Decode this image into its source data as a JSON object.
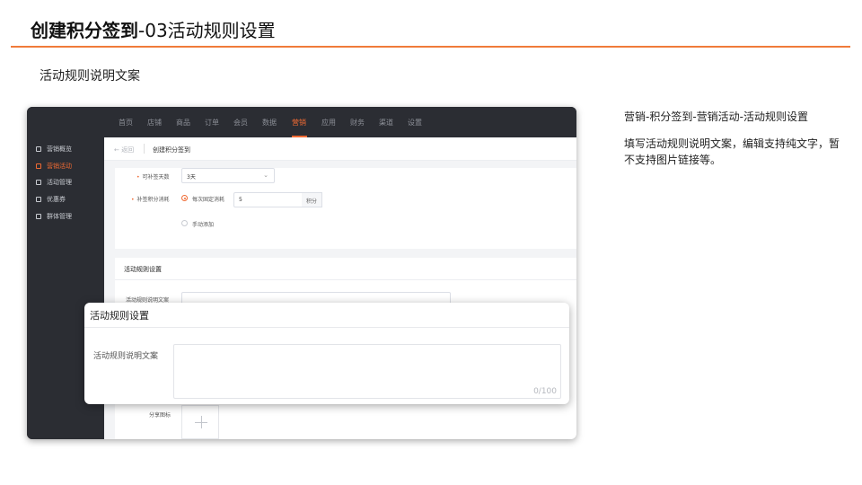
{
  "slide": {
    "title_bold": "创建积分签到",
    "title_rest": "-03活动规则设置",
    "subtitle": "活动规则说明文案"
  },
  "colors": {
    "accent": "#f06a33",
    "rule": "#f07b3a",
    "nav_bg": "#2b2d33"
  },
  "topnav": {
    "items": [
      "首页",
      "店铺",
      "商品",
      "订单",
      "会员",
      "数据",
      "营销",
      "应用",
      "财务",
      "渠道",
      "设置"
    ],
    "active": "营销"
  },
  "sidebar": {
    "items": [
      {
        "label": "营销概览",
        "icon": "overview-icon",
        "active": false
      },
      {
        "label": "营销活动",
        "icon": "tag-icon",
        "active": true
      },
      {
        "label": "活动管理",
        "icon": "calendar-icon",
        "active": false
      },
      {
        "label": "优惠券",
        "icon": "coupon-icon",
        "active": false
      },
      {
        "label": "群体管理",
        "icon": "group-icon",
        "active": false
      }
    ]
  },
  "breadcrumb": {
    "back": "← 返回",
    "title": "创建积分签到"
  },
  "form": {
    "makeup_days_label": "可补签天数",
    "makeup_days_value": "3天",
    "makeup_points_label": "补签积分消耗",
    "option_fixed": "每次固定消耗",
    "fixed_value": "5",
    "fixed_unit": "积分",
    "option_manual": "手动添加",
    "rules_section": "活动规则设置",
    "rules_text_label": "活动规则说明文案",
    "share_icon_label": "分享图标"
  },
  "modal": {
    "title": "活动规则设置",
    "field_label": "活动规则说明文案",
    "counter": "0/100"
  },
  "description": {
    "path": "营销-积分签到-营销活动-活动规则设置",
    "note": "填写活动规则说明文案，编辑支持纯文字，暂不支持图片链接等。"
  }
}
